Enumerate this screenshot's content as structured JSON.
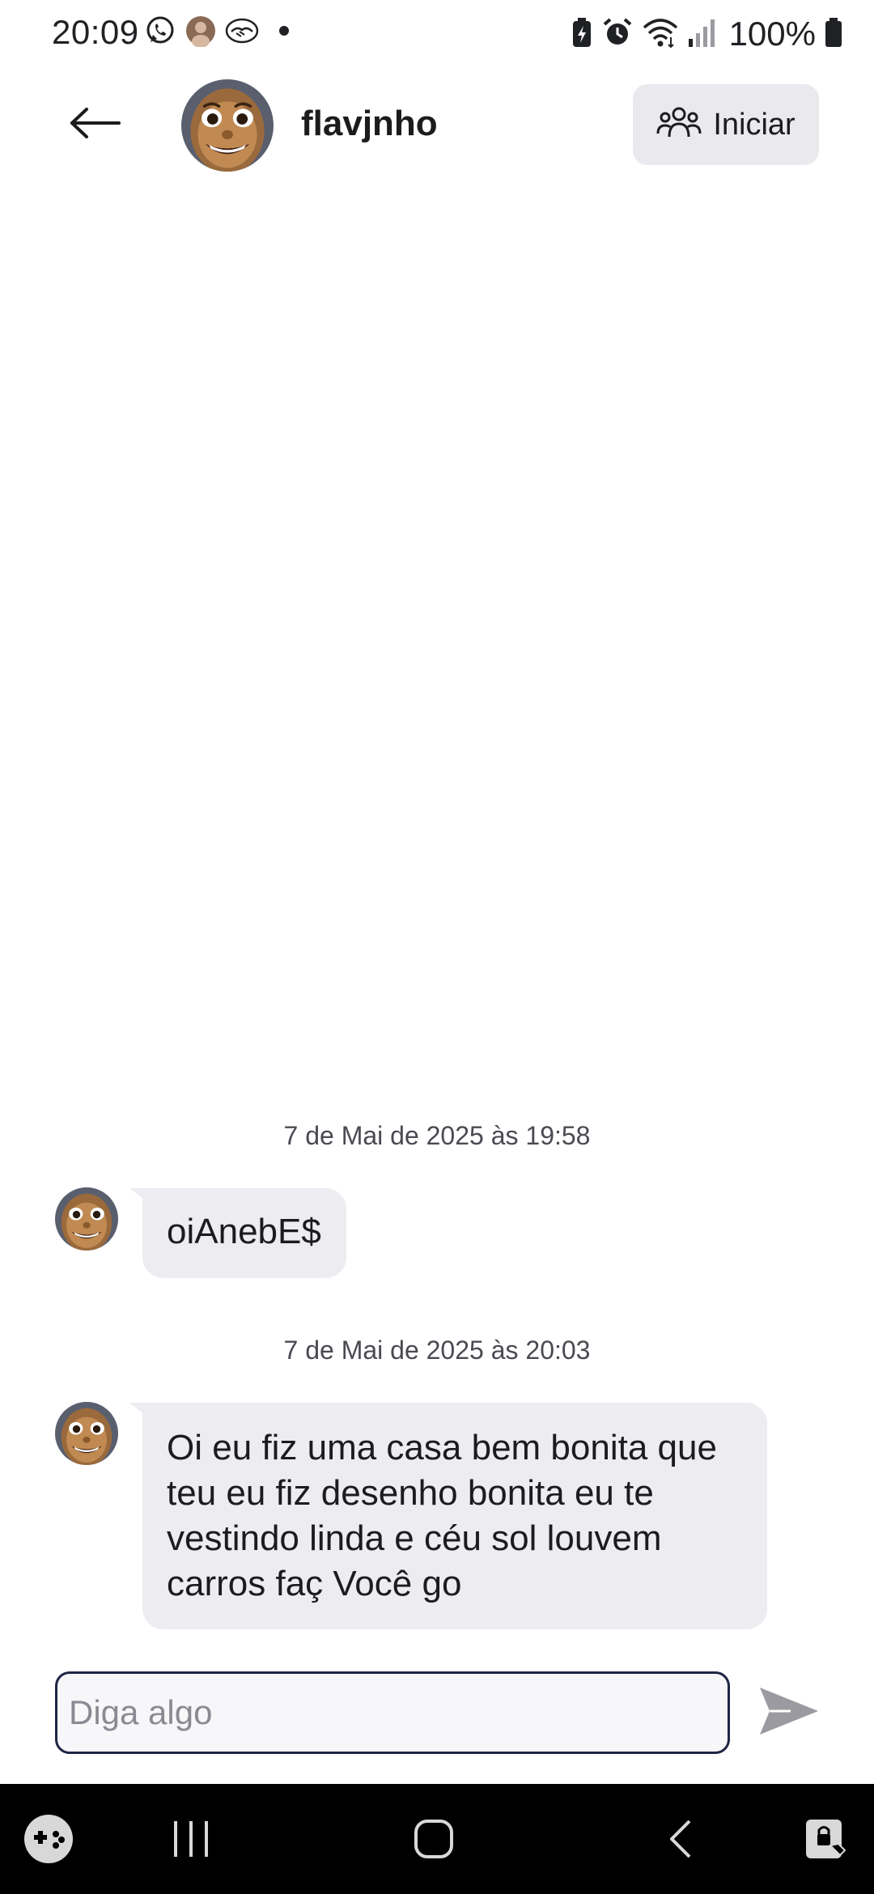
{
  "status_bar": {
    "time": "20:09",
    "battery": "100%",
    "left_icons": [
      "whatsapp-icon",
      "profile-notification-icon",
      "handshake-icon",
      "dot-icon"
    ],
    "right_icons": [
      "battery-saver-icon",
      "alarm-icon",
      "wifi-icon",
      "signal-icon",
      "battery-icon"
    ]
  },
  "header": {
    "username": "flavjnho",
    "start_label": "Iniciar",
    "back_icon": "arrow-left-icon",
    "start_icon": "group-icon"
  },
  "messages": [
    {
      "timestamp": "7 de Mai de 2025 às 19:58",
      "lines": [
        "oiAnebE$"
      ]
    },
    {
      "timestamp": "7 de Mai de 2025 às 20:03",
      "lines": [
        "Oi eu fiz uma casa bem bonita que",
        "teu eu fiz desenho bonita eu te",
        "vestindo linda e céu sol louvem",
        "carros faç Você go"
      ]
    }
  ],
  "composer": {
    "placeholder": "Diga algo",
    "value": "",
    "send_icon": "send-icon"
  },
  "nav_bar": {
    "icons": [
      "game-launcher-icon",
      "recent-apps-icon",
      "home-icon",
      "back-icon",
      "secure-folder-icon"
    ]
  },
  "colors": {
    "bubble": "#ececf1",
    "button_bg": "#e9e9ee",
    "input_border": "#1f2544",
    "nav_bg": "#000000",
    "avatar_skin": "#b07a45"
  }
}
